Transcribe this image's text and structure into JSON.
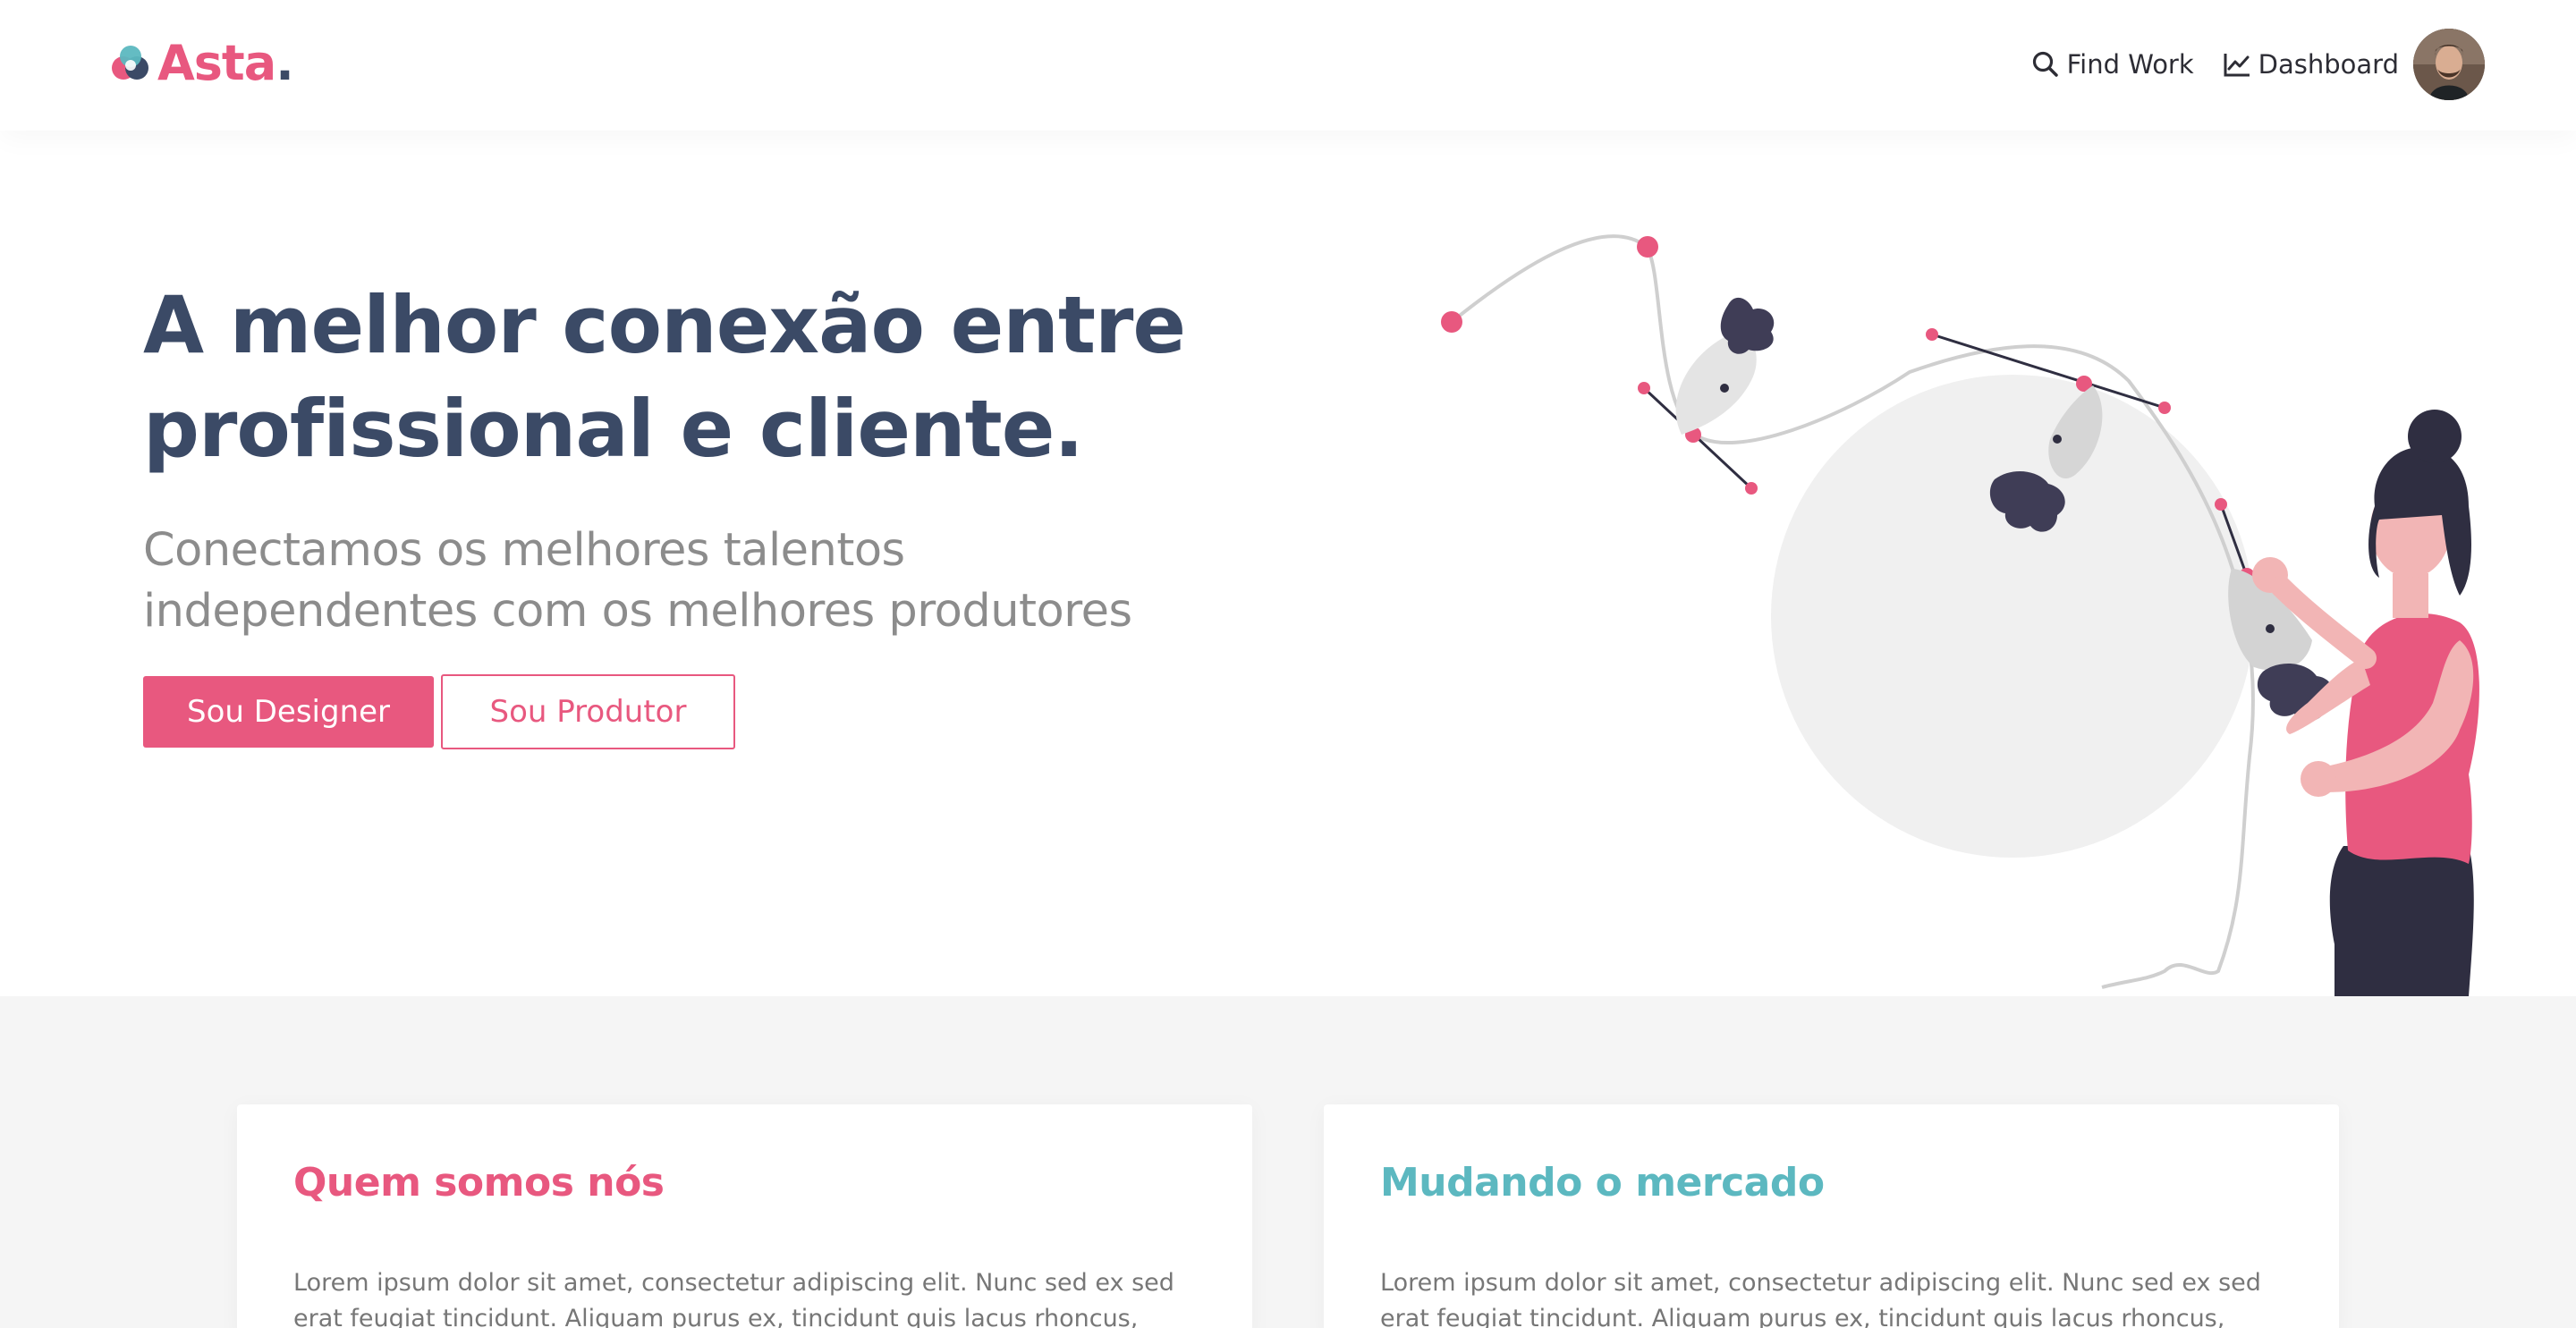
{
  "nav": {
    "brand": "Asta",
    "brand_dot": ".",
    "find_work": "Find Work",
    "dashboard": "Dashboard"
  },
  "hero": {
    "title_line1": "A melhor conexão entre",
    "title_line2": "profissional e cliente.",
    "subtitle_line1": "Conectamos os melhores talentos",
    "subtitle_line2": "independentes com os melhores produtores",
    "designer_button": "Sou Designer",
    "producer_button": "Sou Produtor"
  },
  "cards": [
    {
      "title": "Quem somos nós",
      "text": "Lorem ipsum dolor sit amet, consectetur adipiscing elit. Nunc sed ex sed erat feugiat tincidunt. Aliquam purus ex, tincidunt quis lacus rhoncus, semper tristique felis."
    },
    {
      "title": "Mudando o mercado",
      "text": "Lorem ipsum dolor sit amet, consectetur adipiscing elit. Nunc sed ex sed erat feugiat tincidunt. Aliquam purus ex, tincidunt quis lacus rhoncus, semper tristique felis."
    }
  ],
  "colors": {
    "brand_pink": "#e8587f",
    "navy": "#3b4a66",
    "teal": "#5cb8c0",
    "muted_gray": "#8c8c8c",
    "section_bg": "#f5f5f5"
  },
  "icons": {
    "find_work": "search-icon",
    "dashboard": "line-chart-icon",
    "logo": "asta-logo-icon"
  }
}
